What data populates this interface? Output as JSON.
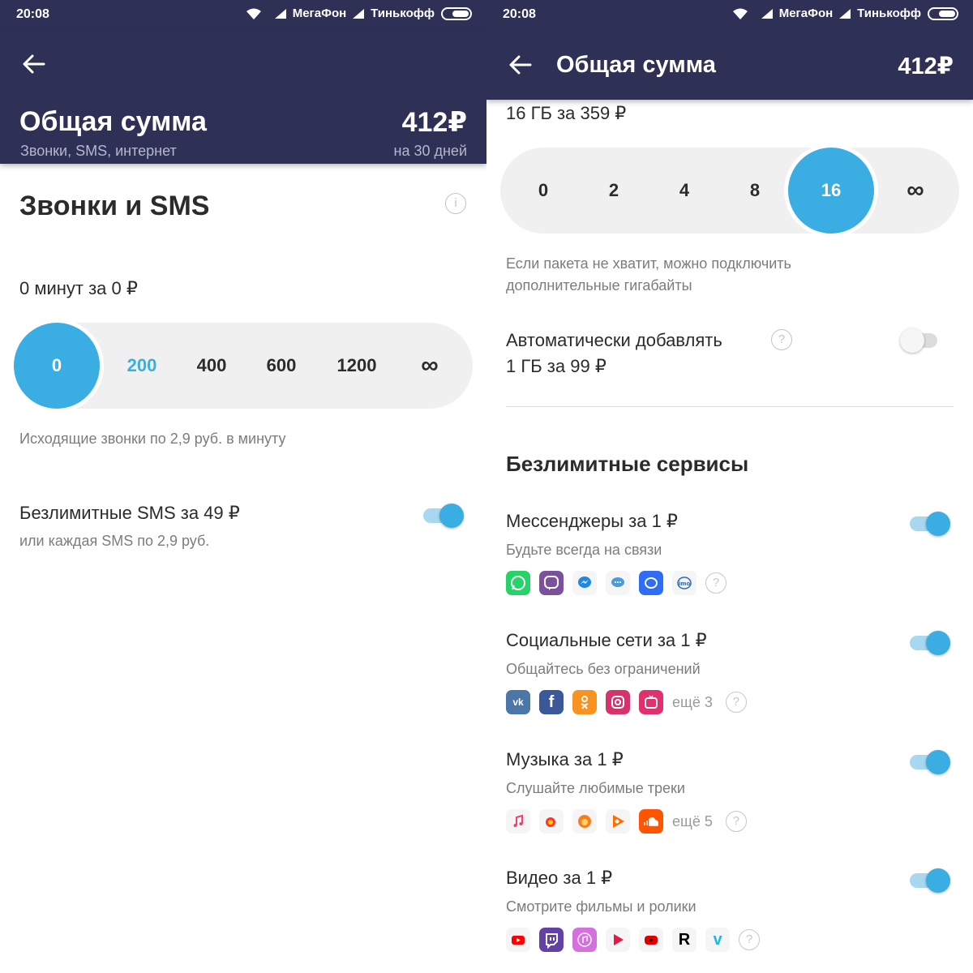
{
  "status_bar": {
    "time": "20:08",
    "carrier1": "МегаФон",
    "carrier2": "Тинькофф"
  },
  "left": {
    "header": {
      "title": "Общая сумма",
      "subtitle": "Звонки, SMS, интернет",
      "price": "412₽",
      "period": "на 30 дней"
    },
    "calls": {
      "title": "Звонки и SMS",
      "info_symbol": "i",
      "amount_label": "0 минут за 0 ₽",
      "options": [
        "0",
        "200",
        "400",
        "600",
        "1200",
        "∞"
      ],
      "selected": "0",
      "note": "Исходящие звонки по 2,9 руб. в минуту"
    },
    "sms": {
      "label": "Безлимитные SMS за 49 ₽",
      "sub": "или каждая SMS по 2,9 руб.",
      "enabled": true
    }
  },
  "right": {
    "header": {
      "title": "Общая сумма",
      "price": "412₽"
    },
    "internet": {
      "amount_label": "16 ГБ за 359 ₽",
      "options": [
        "0",
        "2",
        "4",
        "8",
        "16",
        "∞"
      ],
      "selected": "16",
      "note_line1": "Если пакета не хватит, можно подключить",
      "note_line2": "дополнительные гигабайты"
    },
    "auto_add": {
      "line1": "Автоматически добавлять",
      "line2": "1 ГБ за 99 ₽",
      "help_symbol": "?",
      "enabled": false
    },
    "unlimited_title": "Безлимитные сервисы",
    "services": [
      {
        "title": "Мессенджеры за 1 ₽",
        "subtitle": "Будьте всегда на связи",
        "more": "",
        "enabled": true,
        "icons": [
          "whatsapp-icon",
          "viber-icon",
          "messenger-icon",
          "bubble-chat-icon",
          "facebook-messenger-icon",
          "imo-icon"
        ]
      },
      {
        "title": "Социальные сети за 1 ₽",
        "subtitle": "Общайтесь без ограничений",
        "more": "ещё 3",
        "enabled": true,
        "icons": [
          "vk-icon",
          "facebook-icon",
          "odnoklassniki-icon",
          "instagram-icon",
          "igtv-icon"
        ]
      },
      {
        "title": "Музыка за 1 ₽",
        "subtitle": "Слушайте любимые треки",
        "more": "ещё 5",
        "enabled": true,
        "icons": [
          "apple-music-icon",
          "yandex-music-icon",
          "boom-icon",
          "google-play-music-icon",
          "soundcloud-icon"
        ]
      },
      {
        "title": "Видео за 1 ₽",
        "subtitle": "Смотрите фильмы и ролики",
        "more": "",
        "enabled": true,
        "icons": [
          "youtube-icon",
          "twitch-icon",
          "itunes-icon",
          "ivi-icon",
          "youtube-red-icon",
          "rutube-icon",
          "vimeo-icon"
        ]
      }
    ],
    "help_symbol": "?"
  },
  "colors": {
    "header_bg": "#2f3055",
    "accent": "#3aaee3",
    "track_bg": "#f0f0f0"
  }
}
